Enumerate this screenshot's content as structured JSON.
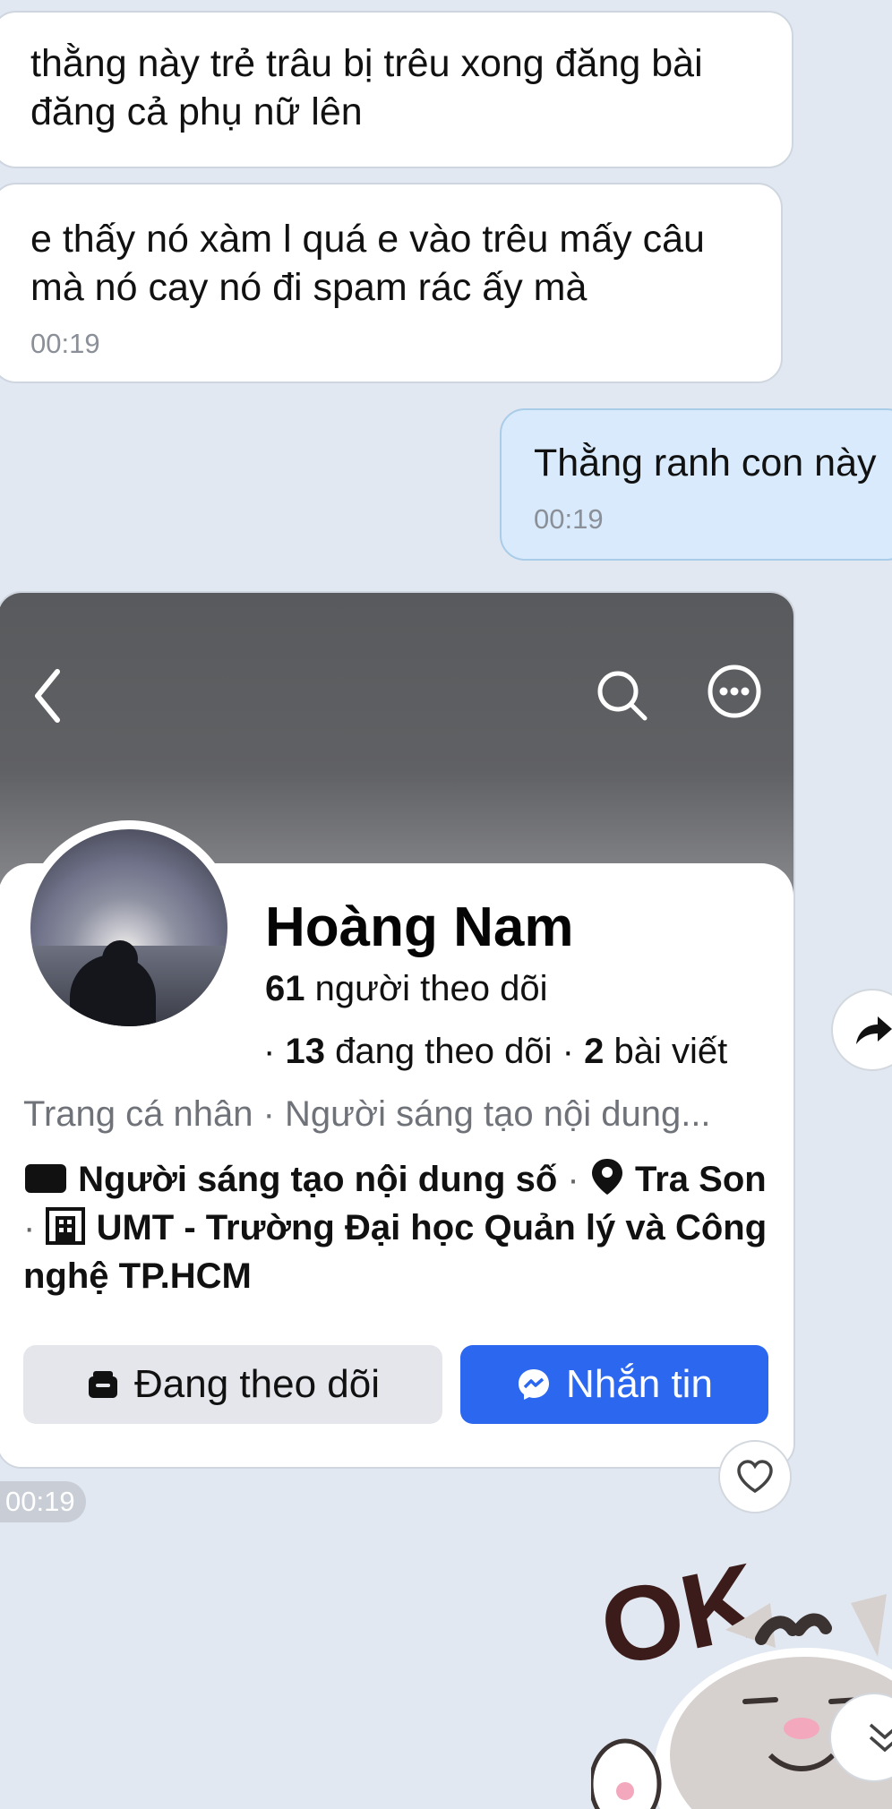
{
  "messages": [
    {
      "text_line1": "thằng này trẻ trâu bị trêu xong đăng bài",
      "text_line2": "đăng cả phụ nữ lên"
    },
    {
      "text_line1": "e thấy nó xàm l quá e vào trêu mấy câu",
      "text_line2": "mà nó cay nó đi spam rác ấy mà",
      "time": "00:19"
    },
    {
      "text": "Thằng ranh con này",
      "time": "00:19"
    }
  ],
  "profile_card": {
    "name": "Hoàng Nam",
    "followers_count": "61",
    "followers_label": "người theo dõi",
    "following_count": "13",
    "following_label": "đang theo dõi",
    "posts_count": "2",
    "posts_label": "bài viết",
    "category": "Trang cá nhân · Người sáng tạo nội dung...",
    "detail_creator": "Người sáng tạo nội dung số",
    "detail_location": "Tra Son",
    "detail_school": "UMT - Trường Đại học Quản lý và Công nghệ TP.HCM",
    "following_button": "Đang theo dõi",
    "message_button": "Nhắn tin",
    "time": "00:19"
  },
  "icons": {
    "back": "back-icon",
    "search": "search-icon",
    "more": "more-icon",
    "share": "share-icon",
    "heart": "heart-icon",
    "scroll_down": "chevron-down-icon"
  },
  "sticker_text": "OK",
  "colors": {
    "background": "#e2e8f1",
    "outgoing_bubble": "#d8eafb",
    "message_button": "#2c67f0"
  }
}
